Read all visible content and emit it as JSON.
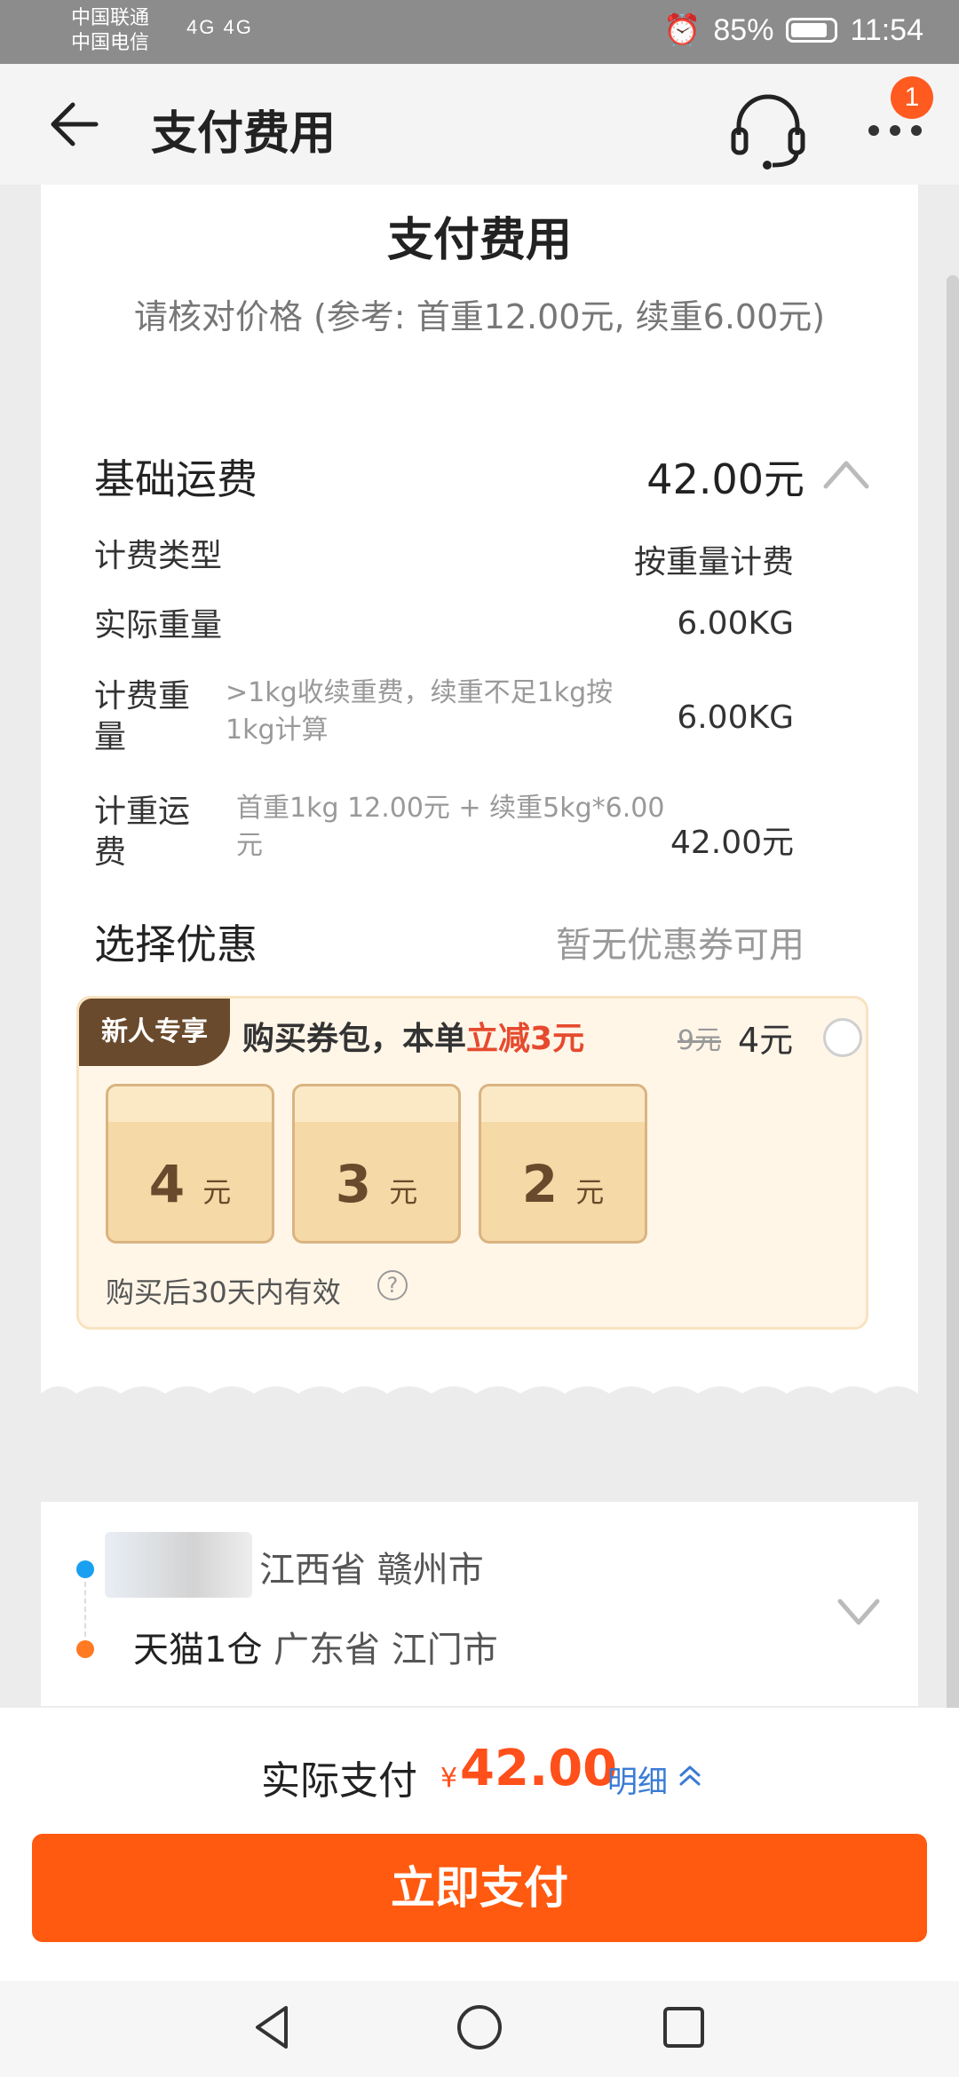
{
  "status_bar": {
    "carrier1": "中国联通",
    "carrier2": "中国电信",
    "signal": "4G 4G",
    "battery": "85%",
    "time": "11:54"
  },
  "nav": {
    "title": "支付费用",
    "badge_count": "1"
  },
  "card": {
    "title": "支付费用",
    "subtitle": "请核对价格 (参考: 首重12.00元, 续重6.00元)",
    "basic_fee_label": "基础运费",
    "basic_fee_value": "42.00元",
    "rows": [
      {
        "label": "计费类型",
        "value": "按重量计费"
      },
      {
        "label": "实际重量",
        "value": "6.00KG"
      },
      {
        "label_line1": "计费重",
        "label_line2": "量",
        "note_line1": ">1kg收续重费，续重不足1kg按",
        "note_line2": "1kg计算",
        "value": "6.00KG"
      },
      {
        "label_line1": "计重运",
        "label_line2": "费",
        "note_line1": "首重1kg 12.00元 + 续重5kg*6.00",
        "note_line2": "元",
        "value": "42.00元"
      }
    ],
    "discount_label": "选择优惠",
    "discount_value": "暂无优惠券可用"
  },
  "coupon": {
    "tag": "新人专享",
    "headline_prefix": "购买券包，本单",
    "headline_highlight": "立减3元",
    "old_price": "9元",
    "new_price": "4元",
    "tickets": [
      {
        "amount": "4",
        "unit": "元"
      },
      {
        "amount": "3",
        "unit": "元"
      },
      {
        "amount": "2",
        "unit": "元"
      }
    ],
    "validity": "购买后30天内有效",
    "help": "?"
  },
  "route": {
    "from": "江西省 赣州市",
    "to_name": "天猫1仓",
    "to_place": "广东省 江门市"
  },
  "payment": {
    "label": "实际支付",
    "currency": "¥",
    "amount": "42.00",
    "detail": "明细",
    "button": "立即支付"
  },
  "colors": {
    "accent": "#ff5a10",
    "price": "#ff4f1a",
    "link": "#3a7bd5",
    "coupon_tag": "#6a4a2c"
  }
}
